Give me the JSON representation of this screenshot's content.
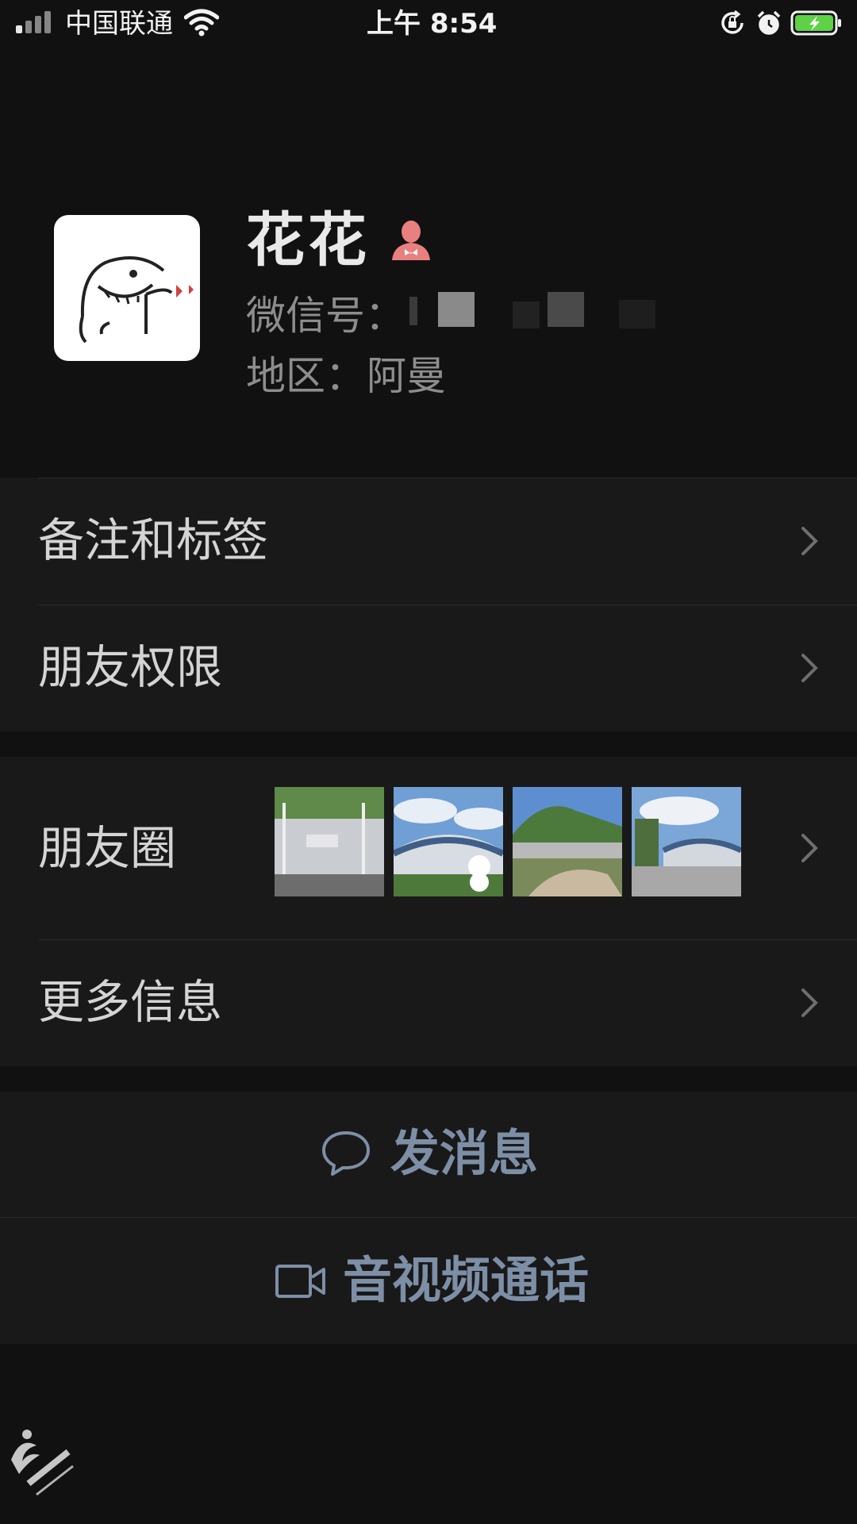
{
  "status_bar": {
    "carrier": "中国联通",
    "time": "上午 8:54",
    "icons": [
      "signal-icon",
      "wifi-icon",
      "rotation-lock-icon",
      "alarm-icon",
      "battery-charging-icon"
    ]
  },
  "header": {
    "back_icon": "back-icon",
    "more_icon": "more-icon"
  },
  "profile": {
    "name": "花花",
    "gender_icon": "female-icon",
    "wechat_id_label": "微信号：",
    "region_label": "地区：",
    "region_value": "阿曼"
  },
  "menu": {
    "remarks_tags": "备注和标签",
    "friend_permissions": "朋友权限",
    "moments": "朋友圈",
    "more_info": "更多信息"
  },
  "actions": {
    "send_message": "发消息",
    "video_call": "音视频通话"
  },
  "colors": {
    "background": "#111111",
    "card": "#191919",
    "action_text": "#7d8fa6",
    "battery": "#5fd146",
    "gender": "#e8807f"
  }
}
